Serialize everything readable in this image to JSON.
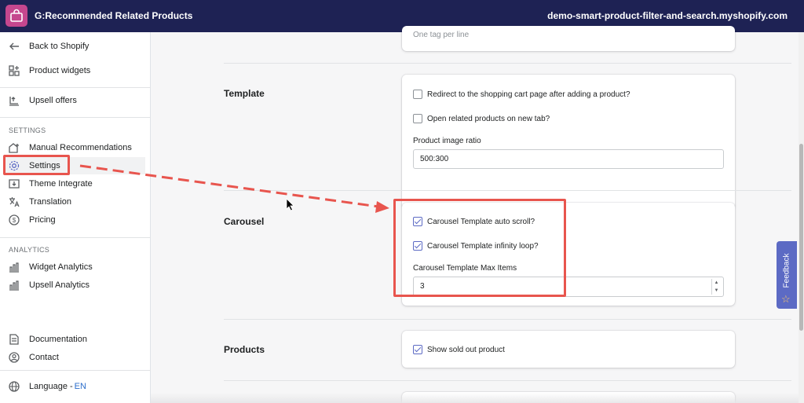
{
  "header": {
    "app_title": "G:Recommended Related Products",
    "store_domain": "demo-smart-product-filter-and-search.myshopify.com",
    "brand_color": "#1e2254",
    "logo_color": "#c5478e"
  },
  "sidebar": {
    "top_items": [
      {
        "label": "Back to Shopify",
        "icon": "arrow-left-icon"
      },
      {
        "label": "Product widgets",
        "icon": "widgets-icon"
      },
      {
        "label": "Upsell offers",
        "icon": "upsell-icon"
      }
    ],
    "settings_heading": "SETTINGS",
    "settings_items": [
      {
        "label": "Manual Recommendations",
        "icon": "home-plus-icon"
      },
      {
        "label": "Settings",
        "icon": "gear-icon",
        "active": true
      },
      {
        "label": "Theme Integrate",
        "icon": "download-box-icon"
      },
      {
        "label": "Translation",
        "icon": "translate-icon"
      },
      {
        "label": "Pricing",
        "icon": "dollar-icon"
      }
    ],
    "analytics_heading": "ANALYTICS",
    "analytics_items": [
      {
        "label": "Widget Analytics",
        "icon": "bar-chart-icon"
      },
      {
        "label": "Upsell Analytics",
        "icon": "bar-chart-icon"
      }
    ],
    "bottom_items": [
      {
        "label": "Documentation",
        "icon": "document-icon"
      },
      {
        "label": "Contact",
        "icon": "person-icon"
      }
    ],
    "language": {
      "label": "Language -",
      "code": "EN",
      "icon": "globe-icon"
    }
  },
  "main": {
    "tags_hint": "One tag per line",
    "template": {
      "title": "Template",
      "redirect_label": "Redirect to the shopping cart page after adding a product?",
      "redirect_checked": false,
      "new_tab_label": "Open related products on new tab?",
      "new_tab_checked": false,
      "ratio_label": "Product image ratio",
      "ratio_value": "500:300"
    },
    "carousel": {
      "title": "Carousel",
      "auto_scroll_label": "Carousel Template auto scroll?",
      "auto_scroll_checked": true,
      "infinity_loop_label": "Carousel Template infinity loop?",
      "infinity_loop_checked": true,
      "max_items_label": "Carousel Template Max Items",
      "max_items_value": "3"
    },
    "products": {
      "title": "Products",
      "sold_out_label": "Show sold out product",
      "sold_out_checked": true
    }
  },
  "feedback": {
    "label": "Feedback",
    "color": "#5c6ac4"
  },
  "annotation": {
    "color": "#e8554e"
  }
}
